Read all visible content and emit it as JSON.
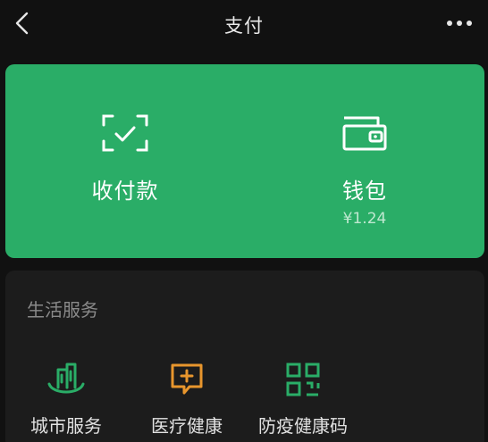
{
  "header": {
    "title": "支付",
    "back_icon": "chevron-left-icon",
    "more_icon": "more-dots-icon"
  },
  "pay_card": {
    "background": "#2aad67",
    "receive": {
      "label": "收付款",
      "icon": "scan-check-icon"
    },
    "wallet": {
      "label": "钱包",
      "balance": "¥1.24",
      "icon": "wallet-icon"
    }
  },
  "services": {
    "title": "生活服务",
    "items": [
      {
        "label": "城市服务",
        "icon": "city-building-icon",
        "color": "#2aad67"
      },
      {
        "label": "医疗健康",
        "icon": "medical-chat-icon",
        "color": "#e8962d"
      },
      {
        "label": "防疫健康码",
        "icon": "qr-code-icon",
        "color": "#2aad67"
      }
    ]
  }
}
